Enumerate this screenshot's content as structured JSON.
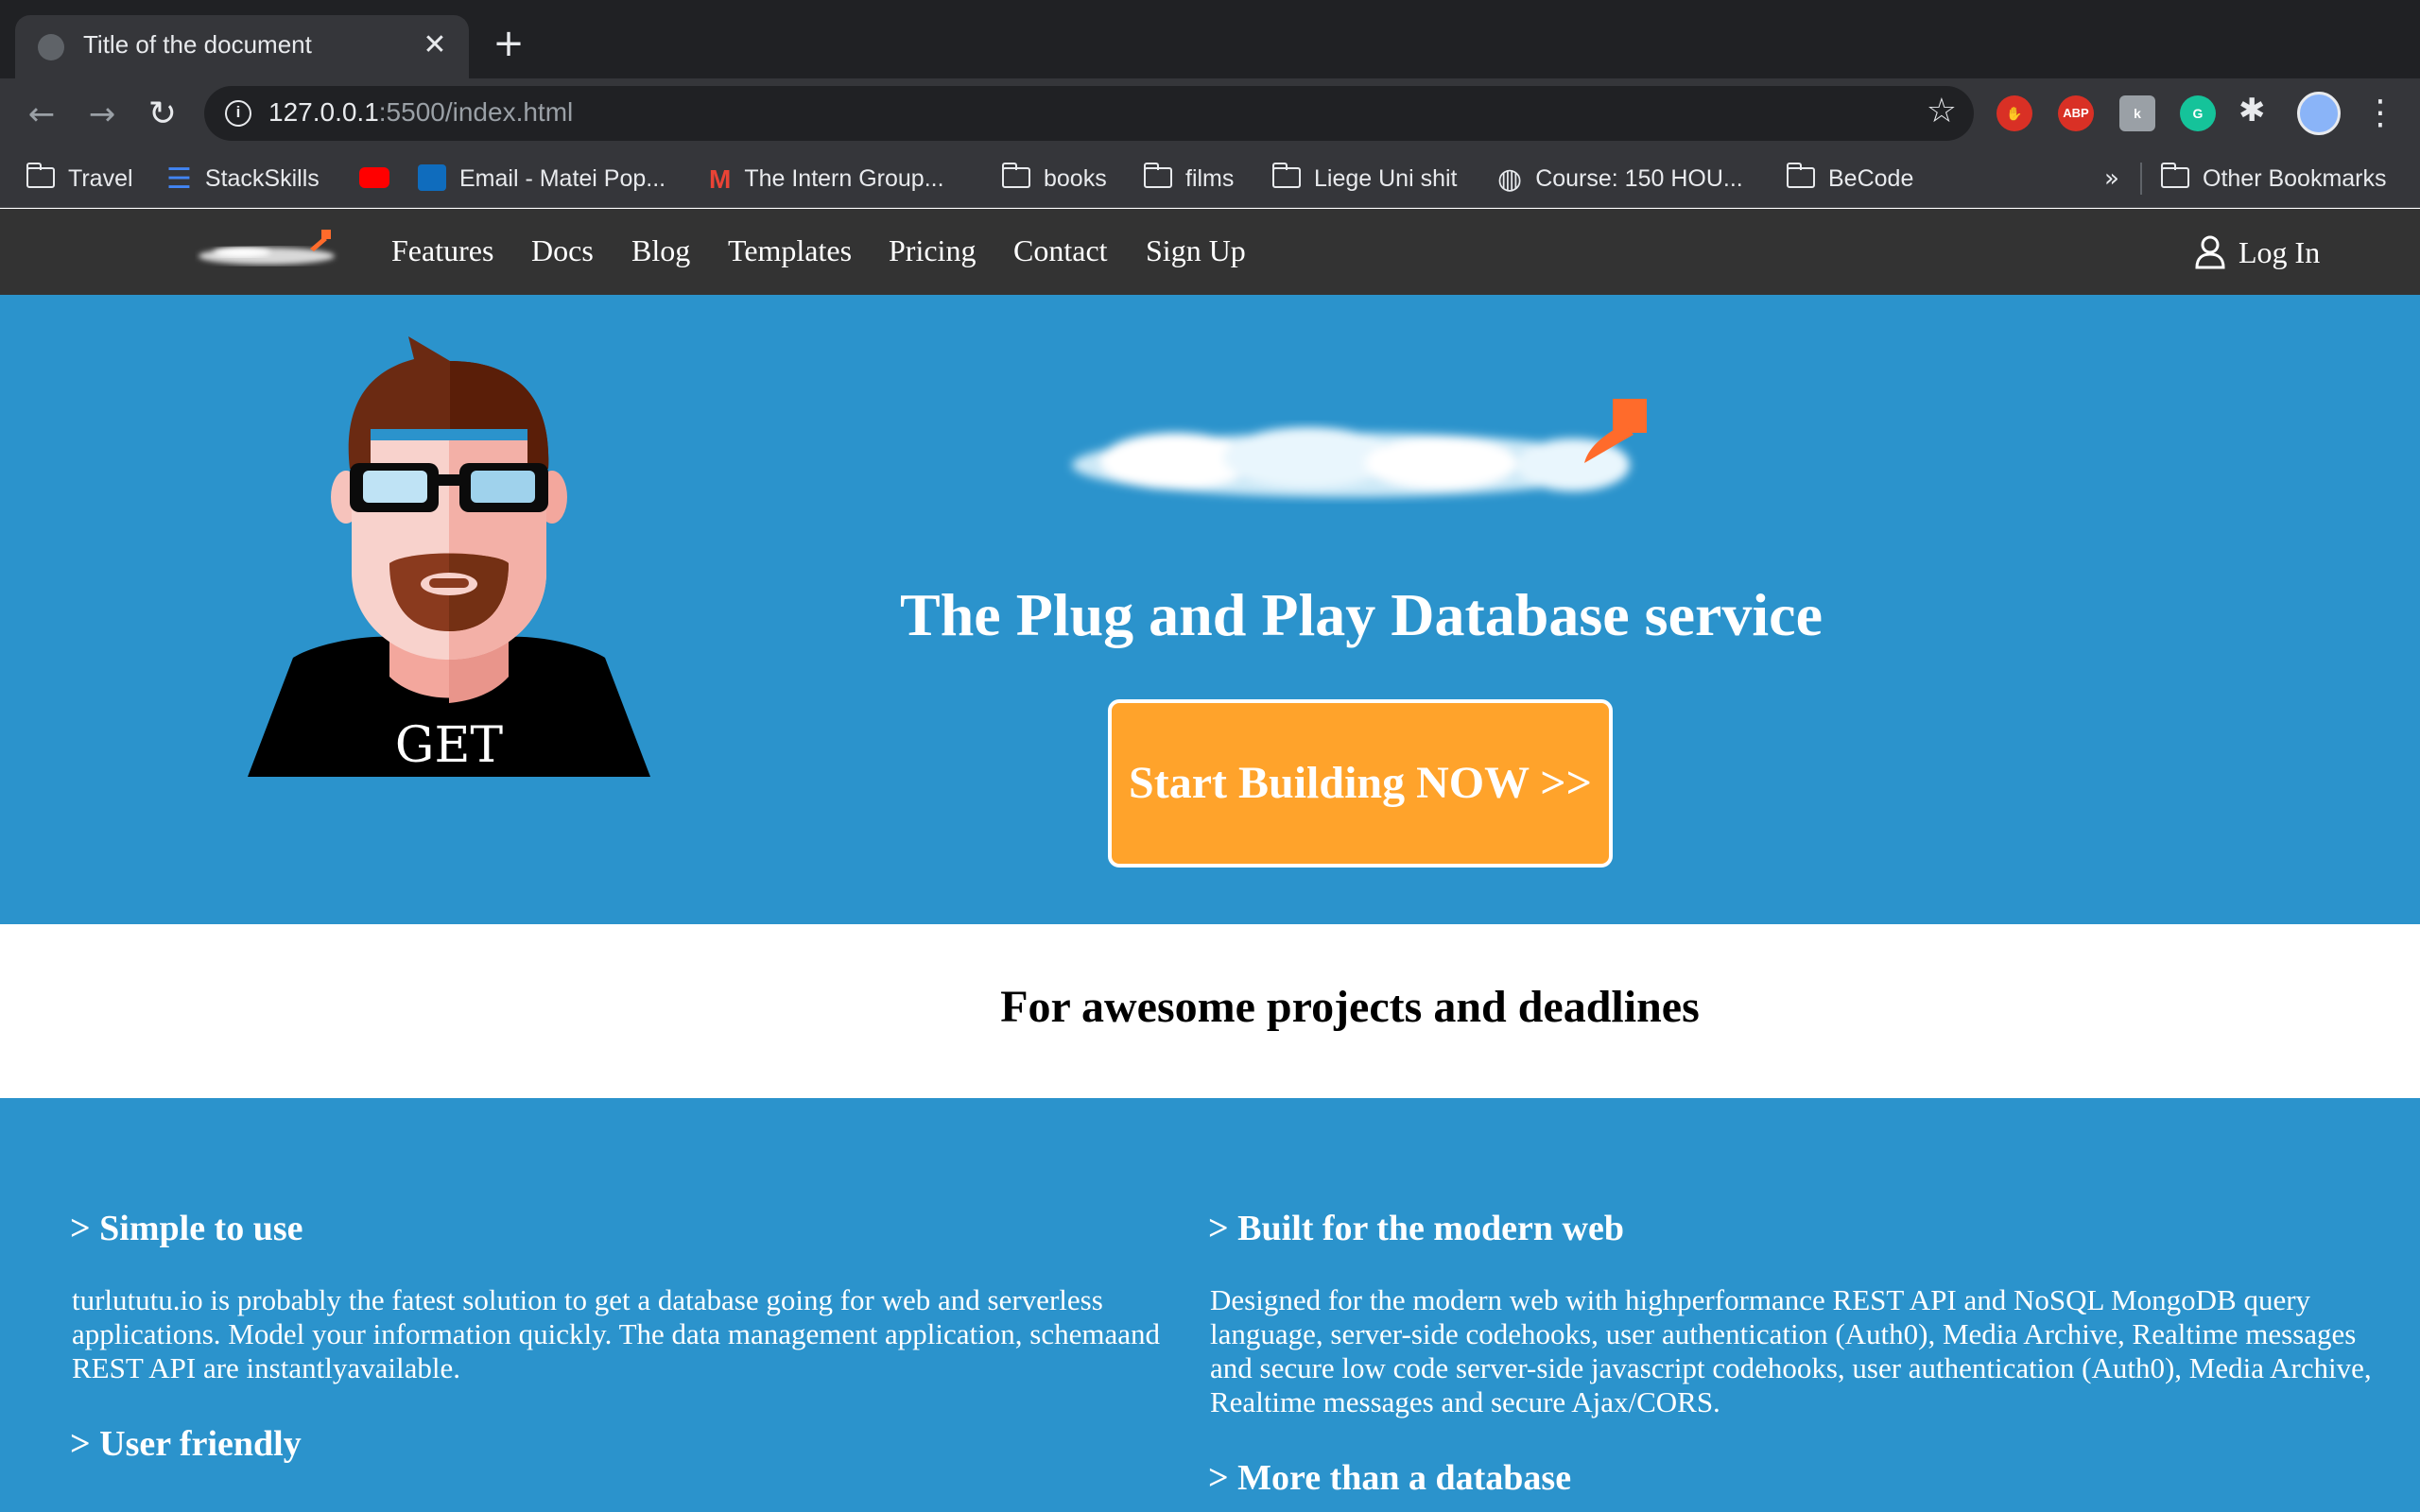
{
  "browser": {
    "tab_title": "Title of the document",
    "tab_close": "✕",
    "new_tab": "+",
    "url_host": "127.0.0.1",
    "url_path": ":5500/index.html",
    "ext_abp": "ABP",
    "bookmarks": [
      {
        "label": "Travel",
        "icon": "folder-icon"
      },
      {
        "label": "StackSkills",
        "icon": "stackskills-icon"
      },
      {
        "label": "",
        "icon": "youtube-icon"
      },
      {
        "label": "Email - Matei Pop...",
        "icon": "outlook-icon"
      },
      {
        "label": "The Intern Group...",
        "icon": "gmail-icon"
      },
      {
        "label": "books",
        "icon": "folder-icon"
      },
      {
        "label": "films",
        "icon": "folder-icon"
      },
      {
        "label": "Liege Uni shit",
        "icon": "folder-icon"
      },
      {
        "label": "Course: 150 HOU...",
        "icon": "globe-icon"
      },
      {
        "label": "BeCode",
        "icon": "folder-icon"
      }
    ],
    "overflow": "»",
    "other_bookmarks": "Other Bookmarks"
  },
  "nav": {
    "links": [
      "Features",
      "Docs",
      "Blog",
      "Templates",
      "Pricing",
      "Contact",
      "Sign Up"
    ],
    "login": "Log In"
  },
  "hero": {
    "mascot_shirt": "GET",
    "title": "The Plug and Play Database service",
    "cta": "Start Building NOW >>"
  },
  "tagline": "For awesome projects and deadlines",
  "features": {
    "left": [
      {
        "title": "> Simple to use",
        "text": "turlututu.io is probably the fatest solution to get a database going for web and serverless applications. Model your information quickly. The data management application, schemaand REST API are instantlyavailable."
      },
      {
        "title": "> User friendly",
        "text": ""
      }
    ],
    "right": [
      {
        "title": "> Built for the modern web",
        "text": "Designed for the modern web with highperformance REST API and NoSQL MongoDB query language, server-side codehooks, user authentication (Auth0), Media Archive, Realtime messages and secure low code server-side javascript codehooks, user authentication (Auth0), Media Archive, Realtime messages and secure Ajax/CORS."
      },
      {
        "title": "> More than a database",
        "text": ""
      }
    ]
  },
  "colors": {
    "hero_bg": "#2b93cc",
    "nav_bg": "#333333",
    "cta_bg": "#ffa32b"
  }
}
